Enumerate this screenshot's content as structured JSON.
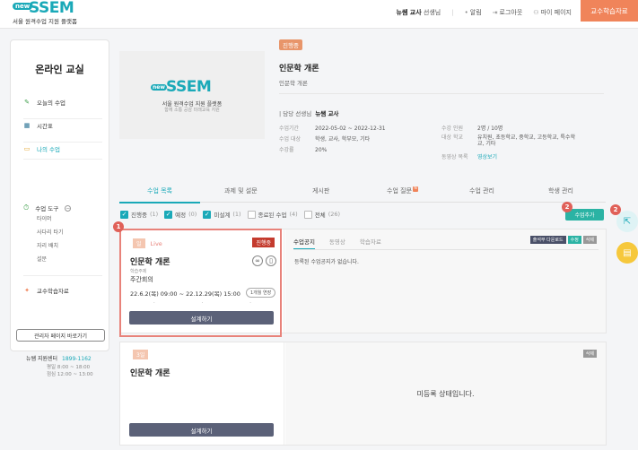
{
  "header": {
    "logo_new": "new",
    "logo_main": "SSEM",
    "logo_sub": "서울 원격수업 지원 플랫폼",
    "user_name": "뉴쌤 교사",
    "user_suffix": "선생님",
    "nav": [
      {
        "icon": "bell-icon",
        "glyph": "🔔",
        "label": "알림"
      },
      {
        "icon": "logout-icon",
        "glyph": "⇥",
        "label": "로그아웃"
      },
      {
        "icon": "person-icon",
        "glyph": "👤",
        "label": "마이 페이지"
      }
    ],
    "cta": "교수학습자료"
  },
  "sidebar": {
    "title": "온라인 교실",
    "items": [
      {
        "label": "오늘의 수업",
        "icon": "pen-icon",
        "glyph": "✎",
        "color": "#3d9e4a"
      },
      {
        "label": "시간표",
        "icon": "calendar-icon",
        "glyph": "▦",
        "color": "#1f6b8f"
      },
      {
        "label": "나의 수업",
        "icon": "monitor-icon",
        "glyph": "▭",
        "color": "#e2a122"
      }
    ],
    "tools_label": "수업 도구",
    "tools_sub": [
      "타이머",
      "사다리 타기",
      "자리 배치",
      "설문"
    ],
    "ref_label": "교수학습자료",
    "admin_btn": "관리자 페이지 바로가기",
    "support_label": "뉴쌤 지원센터",
    "support_phone": "1899-1162",
    "hours": [
      "평일 8:00 ~ 18:00",
      "점심 12:00 ~ 13:00"
    ]
  },
  "course": {
    "thumb_new": "new",
    "thumb_main": "SSEM",
    "thumb_sub1": "서울 원격수업 지원 플랫폼",
    "thumb_sub2": "함께 소통 공감 미래교육 지원",
    "status": "진행중",
    "title": "인문학 개론",
    "subtitle": "인문학 개론",
    "teacher_label": "담당 선생님",
    "teacher_name": "뉴쌤 교사",
    "details_left": [
      {
        "k": "수업기간",
        "v": "2022-05-02 ~ 2022-12-31"
      },
      {
        "k": "수업 대상",
        "v": "학생, 교사, 학부모, 기타"
      },
      {
        "k": "수강률",
        "v": "20%"
      }
    ],
    "details_right": [
      {
        "k": "수강 인원",
        "v": "2명 / 10명"
      },
      {
        "k": "대상 학교",
        "v": "유치원, 초등학교, 중학교, 고등학교, 특수학교, 기타"
      },
      {
        "k": "동영상 목록",
        "v": "영상보기"
      }
    ]
  },
  "tabs": [
    {
      "label": "수업 목록"
    },
    {
      "label": "과제 및 설문"
    },
    {
      "label": "게시판"
    },
    {
      "label": "수업 질문",
      "dot": "N"
    },
    {
      "label": "수업 관리"
    },
    {
      "label": "학생 관리"
    }
  ],
  "filters": [
    {
      "label": "진행중",
      "count": "(1)",
      "on": true
    },
    {
      "label": "예정",
      "count": "(0)",
      "on": true
    },
    {
      "label": "미설계",
      "count": "(1)",
      "on": true
    },
    {
      "label": "종료된 수업",
      "count": "(4)",
      "on": false
    },
    {
      "label": "전체",
      "count": "(26)",
      "on": false
    }
  ],
  "add_btn": "수업추가",
  "badges": [
    "1",
    "2",
    "2"
  ],
  "card1": {
    "day": "일",
    "live": "Live",
    "status": "진행중",
    "title": "인문학 개론",
    "kind": "학습주제",
    "meet": "주간회의",
    "date": "22.6.2(목) 09:00 ~ 22.12.29(목) 15:00",
    "onetime": "1개월 연장",
    "btn": "설계하기",
    "right_tabs": [
      "수업공지",
      "동영상",
      "학습자료"
    ],
    "right_btns": [
      {
        "label": "출석부 다운로드",
        "color": "#4a5068"
      },
      {
        "label": "수정",
        "color": "#2bb3a4"
      },
      {
        "label": "삭제",
        "color": "#999999"
      }
    ],
    "empty": "등록된 수업공지가 없습니다."
  },
  "card2": {
    "day": "3일",
    "title": "인문학 개론",
    "btn": "설계하기",
    "del": "삭제",
    "unreg": "미등록 상태입니다."
  }
}
